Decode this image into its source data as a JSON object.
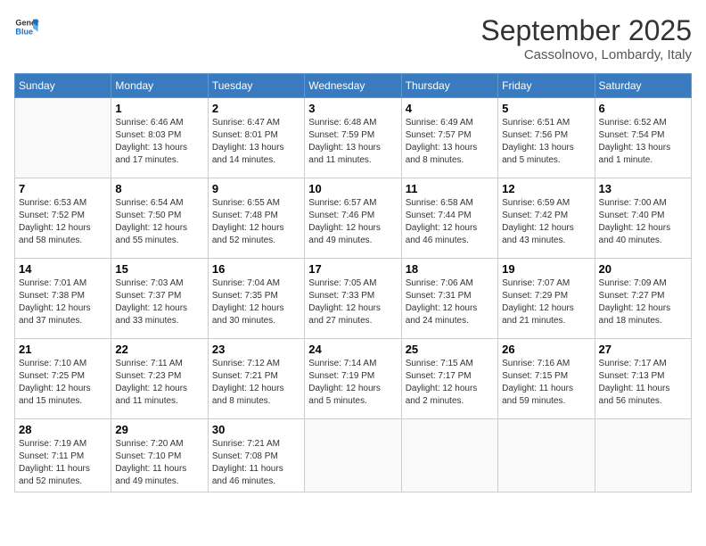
{
  "header": {
    "logo_line1": "General",
    "logo_line2": "Blue",
    "month": "September 2025",
    "location": "Cassolnovo, Lombardy, Italy"
  },
  "weekdays": [
    "Sunday",
    "Monday",
    "Tuesday",
    "Wednesday",
    "Thursday",
    "Friday",
    "Saturday"
  ],
  "weeks": [
    [
      {
        "day": "",
        "info": ""
      },
      {
        "day": "1",
        "info": "Sunrise: 6:46 AM\nSunset: 8:03 PM\nDaylight: 13 hours\nand 17 minutes."
      },
      {
        "day": "2",
        "info": "Sunrise: 6:47 AM\nSunset: 8:01 PM\nDaylight: 13 hours\nand 14 minutes."
      },
      {
        "day": "3",
        "info": "Sunrise: 6:48 AM\nSunset: 7:59 PM\nDaylight: 13 hours\nand 11 minutes."
      },
      {
        "day": "4",
        "info": "Sunrise: 6:49 AM\nSunset: 7:57 PM\nDaylight: 13 hours\nand 8 minutes."
      },
      {
        "day": "5",
        "info": "Sunrise: 6:51 AM\nSunset: 7:56 PM\nDaylight: 13 hours\nand 5 minutes."
      },
      {
        "day": "6",
        "info": "Sunrise: 6:52 AM\nSunset: 7:54 PM\nDaylight: 13 hours\nand 1 minute."
      }
    ],
    [
      {
        "day": "7",
        "info": "Sunrise: 6:53 AM\nSunset: 7:52 PM\nDaylight: 12 hours\nand 58 minutes."
      },
      {
        "day": "8",
        "info": "Sunrise: 6:54 AM\nSunset: 7:50 PM\nDaylight: 12 hours\nand 55 minutes."
      },
      {
        "day": "9",
        "info": "Sunrise: 6:55 AM\nSunset: 7:48 PM\nDaylight: 12 hours\nand 52 minutes."
      },
      {
        "day": "10",
        "info": "Sunrise: 6:57 AM\nSunset: 7:46 PM\nDaylight: 12 hours\nand 49 minutes."
      },
      {
        "day": "11",
        "info": "Sunrise: 6:58 AM\nSunset: 7:44 PM\nDaylight: 12 hours\nand 46 minutes."
      },
      {
        "day": "12",
        "info": "Sunrise: 6:59 AM\nSunset: 7:42 PM\nDaylight: 12 hours\nand 43 minutes."
      },
      {
        "day": "13",
        "info": "Sunrise: 7:00 AM\nSunset: 7:40 PM\nDaylight: 12 hours\nand 40 minutes."
      }
    ],
    [
      {
        "day": "14",
        "info": "Sunrise: 7:01 AM\nSunset: 7:38 PM\nDaylight: 12 hours\nand 37 minutes."
      },
      {
        "day": "15",
        "info": "Sunrise: 7:03 AM\nSunset: 7:37 PM\nDaylight: 12 hours\nand 33 minutes."
      },
      {
        "day": "16",
        "info": "Sunrise: 7:04 AM\nSunset: 7:35 PM\nDaylight: 12 hours\nand 30 minutes."
      },
      {
        "day": "17",
        "info": "Sunrise: 7:05 AM\nSunset: 7:33 PM\nDaylight: 12 hours\nand 27 minutes."
      },
      {
        "day": "18",
        "info": "Sunrise: 7:06 AM\nSunset: 7:31 PM\nDaylight: 12 hours\nand 24 minutes."
      },
      {
        "day": "19",
        "info": "Sunrise: 7:07 AM\nSunset: 7:29 PM\nDaylight: 12 hours\nand 21 minutes."
      },
      {
        "day": "20",
        "info": "Sunrise: 7:09 AM\nSunset: 7:27 PM\nDaylight: 12 hours\nand 18 minutes."
      }
    ],
    [
      {
        "day": "21",
        "info": "Sunrise: 7:10 AM\nSunset: 7:25 PM\nDaylight: 12 hours\nand 15 minutes."
      },
      {
        "day": "22",
        "info": "Sunrise: 7:11 AM\nSunset: 7:23 PM\nDaylight: 12 hours\nand 11 minutes."
      },
      {
        "day": "23",
        "info": "Sunrise: 7:12 AM\nSunset: 7:21 PM\nDaylight: 12 hours\nand 8 minutes."
      },
      {
        "day": "24",
        "info": "Sunrise: 7:14 AM\nSunset: 7:19 PM\nDaylight: 12 hours\nand 5 minutes."
      },
      {
        "day": "25",
        "info": "Sunrise: 7:15 AM\nSunset: 7:17 PM\nDaylight: 12 hours\nand 2 minutes."
      },
      {
        "day": "26",
        "info": "Sunrise: 7:16 AM\nSunset: 7:15 PM\nDaylight: 11 hours\nand 59 minutes."
      },
      {
        "day": "27",
        "info": "Sunrise: 7:17 AM\nSunset: 7:13 PM\nDaylight: 11 hours\nand 56 minutes."
      }
    ],
    [
      {
        "day": "28",
        "info": "Sunrise: 7:19 AM\nSunset: 7:11 PM\nDaylight: 11 hours\nand 52 minutes."
      },
      {
        "day": "29",
        "info": "Sunrise: 7:20 AM\nSunset: 7:10 PM\nDaylight: 11 hours\nand 49 minutes."
      },
      {
        "day": "30",
        "info": "Sunrise: 7:21 AM\nSunset: 7:08 PM\nDaylight: 11 hours\nand 46 minutes."
      },
      {
        "day": "",
        "info": ""
      },
      {
        "day": "",
        "info": ""
      },
      {
        "day": "",
        "info": ""
      },
      {
        "day": "",
        "info": ""
      }
    ]
  ]
}
